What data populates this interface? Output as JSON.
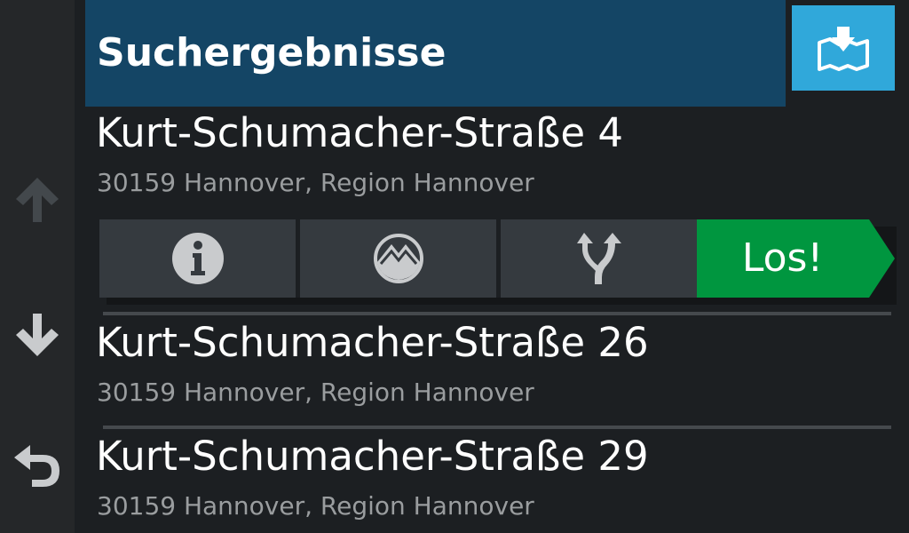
{
  "header": {
    "title": "Suchergebnisse"
  },
  "rail": {
    "icons": [
      "arrow-up-icon",
      "arrow-down-icon",
      "back-icon"
    ]
  },
  "results": [
    {
      "name": "Kurt-Schumacher-Straße 4",
      "address": "30159 Hannover, Region Hannover"
    },
    {
      "name": "Kurt-Schumacher-Straße 26",
      "address": "30159 Hannover, Region Hannover"
    },
    {
      "name": "Kurt-Schumacher-Straße 29",
      "address": "30159 Hannover, Region Hannover"
    }
  ],
  "actions": {
    "icons": [
      "info-icon",
      "map-preview-icon",
      "route-split-icon",
      "map-pin-icon"
    ],
    "go_label": "Los!"
  },
  "colors": {
    "header_bg": "#144565",
    "map_button_bg": "#30a8da",
    "go_button_bg": "#00963f",
    "action_button_bg": "#353a3f",
    "background": "#1c1f22"
  }
}
